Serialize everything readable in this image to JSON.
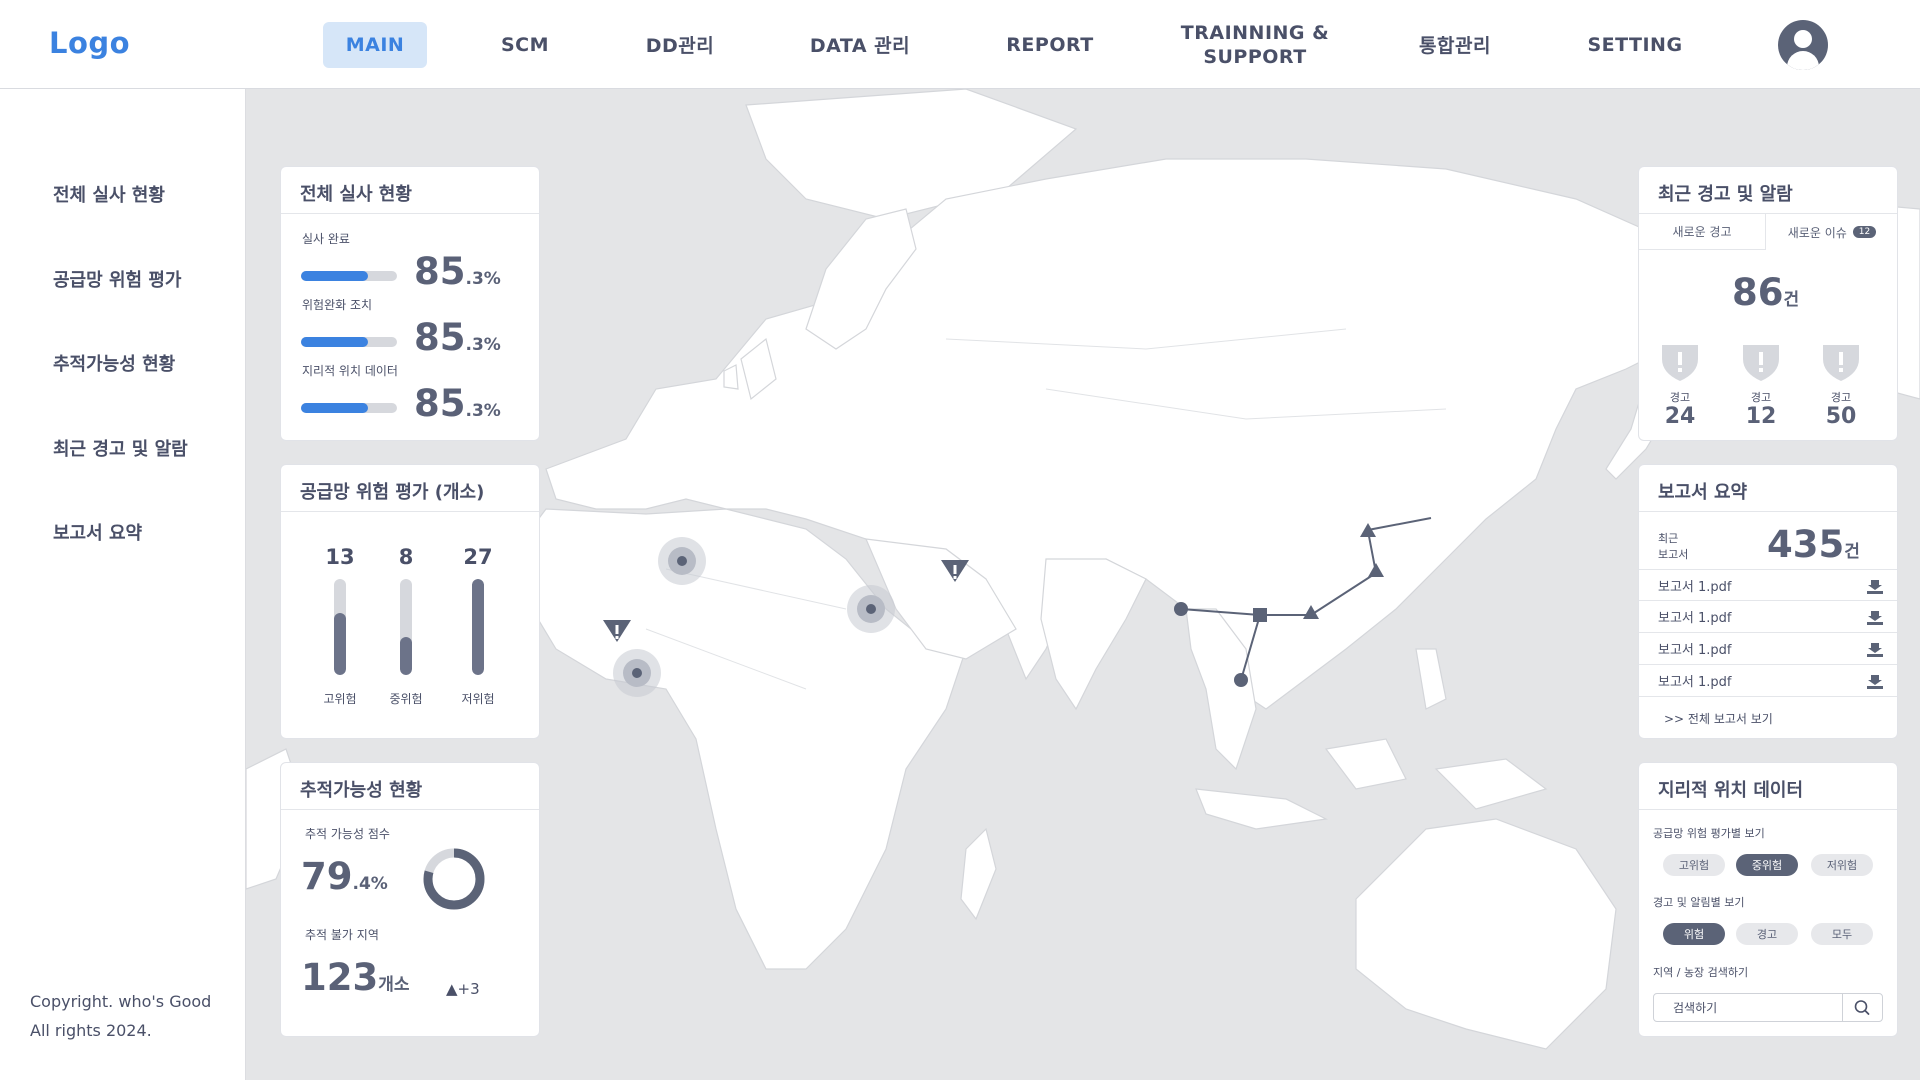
{
  "header": {
    "logo": "Logo",
    "nav": [
      {
        "label": "MAIN",
        "active": true
      },
      {
        "label": "SCM"
      },
      {
        "label": "DD관리"
      },
      {
        "label": "DATA 관리"
      },
      {
        "label": "REPORT"
      },
      {
        "label_line1": "TRAINNING &",
        "label_line2": "SUPPORT"
      },
      {
        "label": "통합관리"
      },
      {
        "label": "SETTING"
      }
    ],
    "avatar_icon": "user-icon"
  },
  "sidebar": {
    "items": [
      "전체 실사 현황",
      "공급망 위험 평가",
      "추적가능성 현황",
      "최근 경고 및 알람",
      "보고서 요약"
    ],
    "copyright_line1": "Copyright. who's Good",
    "copyright_line2": "All rights 2024."
  },
  "audit": {
    "title": "전체 실사 현황",
    "rows": [
      {
        "label": "실사 완료",
        "int": "85",
        "dec": ".3%",
        "progress": 0.853
      },
      {
        "label": "위험완화 조치",
        "int": "85",
        "dec": ".3%",
        "progress": 0.853
      },
      {
        "label": "지리적 위치 데이터",
        "int": "85",
        "dec": ".3%",
        "progress": 0.853
      }
    ]
  },
  "risk": {
    "title": "공급망 위험 평가 (개소)",
    "columns": [
      {
        "value": "13",
        "label": "고위험",
        "level": 0.65
      },
      {
        "value": "8",
        "label": "중위험",
        "level": 0.4
      },
      {
        "value": "27",
        "label": "저위험",
        "level": 1.0
      }
    ]
  },
  "trace": {
    "title": "추적가능성 현황",
    "score_label": "추적 가능성 점수",
    "score_int": "79",
    "score_dec": ".4%",
    "score": 0.794,
    "unreach_label": "추적 불가 지역",
    "unreach_num": "123",
    "unreach_unit": "개소",
    "delta": "▲+3"
  },
  "alerts": {
    "title": "최근 경고 및 알람",
    "tabs": [
      {
        "label": "새로운 경고"
      },
      {
        "label": "새로운 이슈",
        "badge": "12"
      }
    ],
    "total": "86",
    "total_unit": "건",
    "items": [
      {
        "label": "경고",
        "value": "24"
      },
      {
        "label": "경고",
        "value": "12"
      },
      {
        "label": "경고",
        "value": "50"
      }
    ]
  },
  "reports": {
    "title": "보고서 요약",
    "recent_label_1": "최근",
    "recent_label_2": "보고서",
    "count": "435",
    "count_unit": "건",
    "files": [
      "보고서 1.pdf",
      "보고서 1.pdf",
      "보고서 1.pdf",
      "보고서 1.pdf"
    ],
    "view_all": ">> 전체 보고서 보기"
  },
  "geo": {
    "title": "지리적 위치 데이터",
    "risk_filter_label": "공급망 위험 평가별 보기",
    "risk_filters": [
      {
        "label": "고위험"
      },
      {
        "label": "중위험",
        "active": true
      },
      {
        "label": "저위험"
      }
    ],
    "alert_filter_label": "경고 및 알림별 보기",
    "alert_filters": [
      {
        "label": "위험",
        "active": true
      },
      {
        "label": "경고"
      },
      {
        "label": "모두"
      }
    ],
    "search_label": "지역 / 농장 검색하기",
    "search_placeholder": "검색하기"
  },
  "colors": {
    "accent": "#3b82e0",
    "nav_active_bg": "#d6e6f8",
    "dark_slate": "#5b6377",
    "map_bg": "#e4e5e7",
    "land": "#ffffff"
  }
}
